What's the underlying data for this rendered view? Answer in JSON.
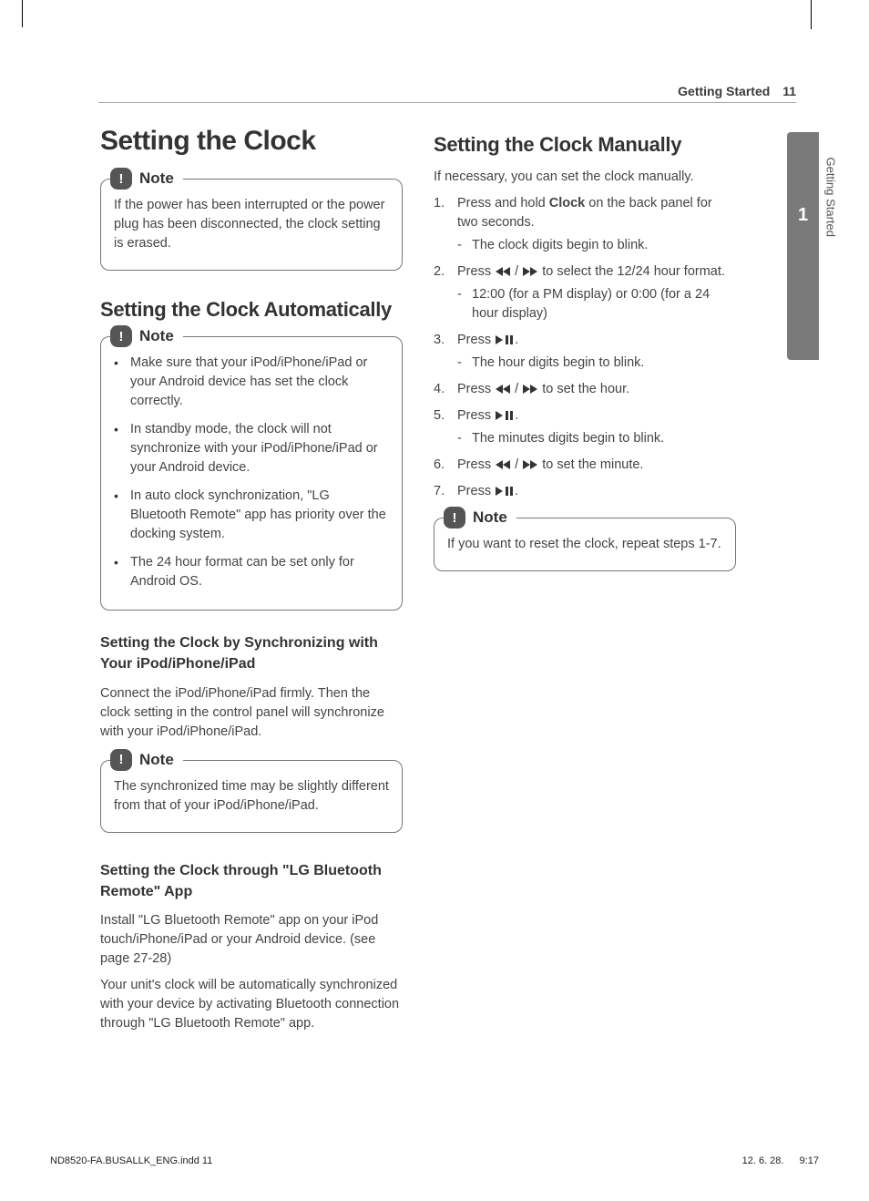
{
  "header": {
    "section": "Getting Started",
    "page_number": "11"
  },
  "side_tab": {
    "number": "1",
    "label": "Getting Started"
  },
  "left": {
    "h1": "Setting the Clock",
    "note1": {
      "label": "Note",
      "text": "If the power has been interrupted or the power plug has been disconnected, the clock setting is erased."
    },
    "h2_auto": "Setting the Clock Automatically",
    "note2": {
      "label": "Note",
      "bullets": [
        "Make sure that your iPod/iPhone/iPad or your Android device has set the clock correctly.",
        "In standby mode, the clock will not synchronize with your iPod/iPhone/iPad or your Android device.",
        "In auto clock synchronization, \"LG Bluetooth Remote\" app has priority over the docking system.",
        "The 24 hour format can be set only for Android OS."
      ]
    },
    "h3_sync": "Setting the Clock by Synchronizing with Your iPod/iPhone/iPad",
    "p_sync": "Connect the iPod/iPhone/iPad firmly. Then the clock setting in the control panel will synchronize with your iPod/iPhone/iPad.",
    "note3": {
      "label": "Note",
      "text": "The synchronized time may be slightly different from that of your iPod/iPhone/iPad."
    },
    "h3_app": "Setting the Clock through \"LG Bluetooth Remote\" App",
    "p_app1": "Install \"LG Bluetooth Remote\" app on your iPod touch/iPhone/iPad or your Android device. (see page 27-28)",
    "p_app2": "Your unit's clock will be automatically synchronized with your device by activating Bluetooth connection through \"LG Bluetooth Remote\" app."
  },
  "right": {
    "h2_manual": "Setting the Clock Manually",
    "p_intro": "If necessary, you can set the clock manually.",
    "steps": {
      "s1_a": "Press and hold ",
      "s1_bold": "Clock",
      "s1_b": " on the back panel for two seconds.",
      "s1_sub": "The clock digits begin to blink.",
      "s2_a": "Press ",
      "s2_b": " to select the 12/24 hour format.",
      "s2_sub": "12:00 (for a PM display) or 0:00 (for a 24 hour display)",
      "s3_a": "Press ",
      "s3_b": ".",
      "s3_sub": "The hour digits begin to blink.",
      "s4_a": "Press ",
      "s4_b": " to set the hour.",
      "s5_a": "Press ",
      "s5_b": ".",
      "s5_sub": "The minutes digits begin to blink.",
      "s6_a": "Press ",
      "s6_b": " to set the minute.",
      "s7_a": "Press ",
      "s7_b": "."
    },
    "note4": {
      "label": "Note",
      "text": "If you want to reset the clock, repeat steps 1-7."
    }
  },
  "footer": {
    "left": "ND8520-FA.BUSALLK_ENG.indd   11",
    "right": "12. 6. 28.      9:17"
  },
  "icons": {
    "slash": " / "
  }
}
